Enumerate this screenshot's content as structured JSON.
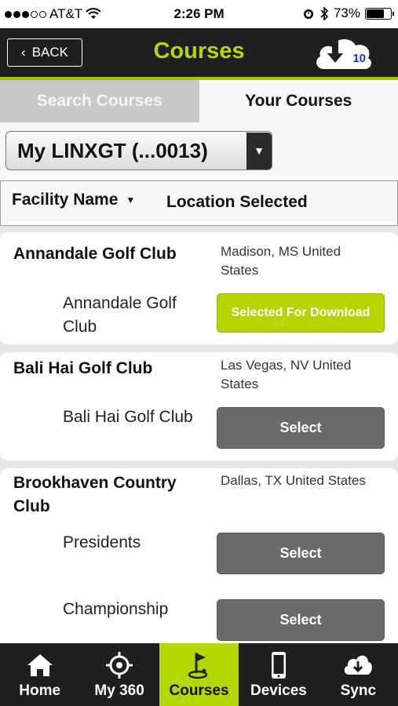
{
  "status": {
    "carrier": "AT&T",
    "time": "2:26 PM",
    "battery": "73%",
    "battery_level": 0.73
  },
  "header": {
    "back_label": "BACK",
    "title": "Courses",
    "download_count": "10"
  },
  "tabs": [
    {
      "label": "Search Courses",
      "active": false
    },
    {
      "label": "Your Courses",
      "active": true
    }
  ],
  "device_select": {
    "value": "My LINXGT (...0013)"
  },
  "sort_bar": {
    "name_label": "Facility Name",
    "location_label": "Location Selected"
  },
  "clubs": [
    {
      "name": "Annandale Golf Club",
      "location_line1": "Madison, MS United",
      "location_line2": "States",
      "courses": [
        {
          "name_line1": "Annandale Golf",
          "name_line2": "Club",
          "button": "Selected For Download"
        }
      ]
    },
    {
      "name": "Bali Hai Golf Club",
      "location_line1": "Las Vegas, NV United",
      "location_line2": "States",
      "courses": [
        {
          "name_line1": "Bali Hai Golf Club",
          "button": "Select"
        }
      ]
    },
    {
      "name_line1": "Brookhaven Country",
      "name_line2": "Club",
      "location_line1": "Dallas, TX United States",
      "courses": [
        {
          "name_line1": "Presidents",
          "button": "Select"
        },
        {
          "name_line1": "Championship",
          "button": "Select"
        }
      ]
    }
  ],
  "nav": [
    {
      "label": "Home",
      "icon": "home-icon"
    },
    {
      "label": "My 360",
      "icon": "crosshair-icon"
    },
    {
      "label": "Courses",
      "icon": "golf-flag-icon",
      "active": true
    },
    {
      "label": "Devices",
      "icon": "phone-icon"
    },
    {
      "label": "Sync",
      "icon": "cloud-sync-icon"
    }
  ],
  "colors": {
    "accent": "#b5d600",
    "header_bg": "#1f1f1f",
    "button_gray": "#6a6a6a",
    "download_count": "#1a2fd8"
  }
}
